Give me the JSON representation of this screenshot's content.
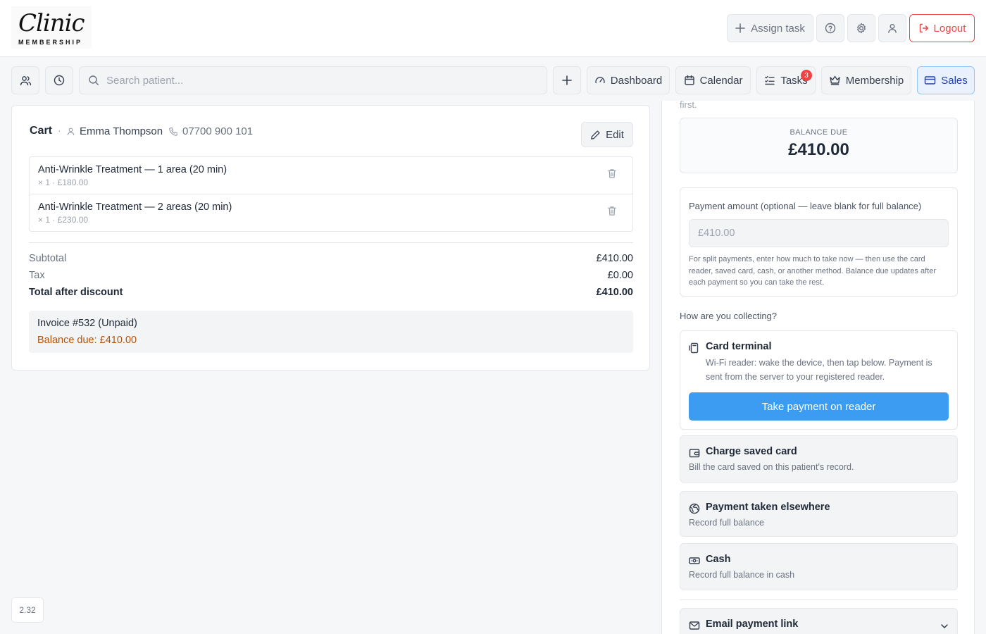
{
  "brand": {
    "logo_script": "Clinic",
    "logo_sub": "MEMBERSHIP"
  },
  "header": {
    "assign_task": "Assign task",
    "logout": "Logout"
  },
  "nav": {
    "search_placeholder": "Search patient...",
    "dashboard": "Dashboard",
    "calendar": "Calendar",
    "tasks": "Tasks",
    "tasks_badge": "3",
    "membership": "Membership",
    "sales": "Sales"
  },
  "cart": {
    "title": "Cart",
    "dot": "·",
    "customer": "Emma Thompson",
    "phone": "07700 900 101",
    "edit": "Edit",
    "items": [
      {
        "name": "Anti-Wrinkle Treatment — 1 area (20 min)",
        "meta": "× 1 · £180.00"
      },
      {
        "name": "Anti-Wrinkle Treatment — 2 areas (20 min)",
        "meta": "× 1 · £230.00"
      }
    ],
    "subtotal_label": "Subtotal",
    "subtotal": "£410.00",
    "tax_label": "Tax",
    "tax": "£0.00",
    "total_label": "Total after discount",
    "total": "£410.00",
    "invoice": "Invoice #532 (Unpaid)",
    "balance_due": "Balance due: £410.00"
  },
  "payment": {
    "cut_text": "first.",
    "balance_label": "BALANCE DUE",
    "balance_amount": "£410.00",
    "amount_label": "Payment amount (optional — leave blank for full balance)",
    "amount_placeholder": "£410.00",
    "amount_help": "For split payments, enter how much to take now — then use the card reader, saved card, cash, or another method. Balance due updates after each payment so you can take the rest.",
    "how_label": "How are you collecting?",
    "terminal_title": "Card terminal",
    "terminal_desc": "Wi-Fi reader: wake the device, then tap below. Payment is sent from the server to your registered reader.",
    "terminal_button": "Take payment on reader",
    "saved_title": "Charge saved card",
    "saved_desc": "Bill the card saved on this patient's record.",
    "elsewhere_title": "Payment taken elsewhere",
    "elsewhere_desc": "Record full balance",
    "cash_title": "Cash",
    "cash_desc": "Record full balance in cash",
    "email_title": "Email payment link"
  },
  "version": "2.32"
}
